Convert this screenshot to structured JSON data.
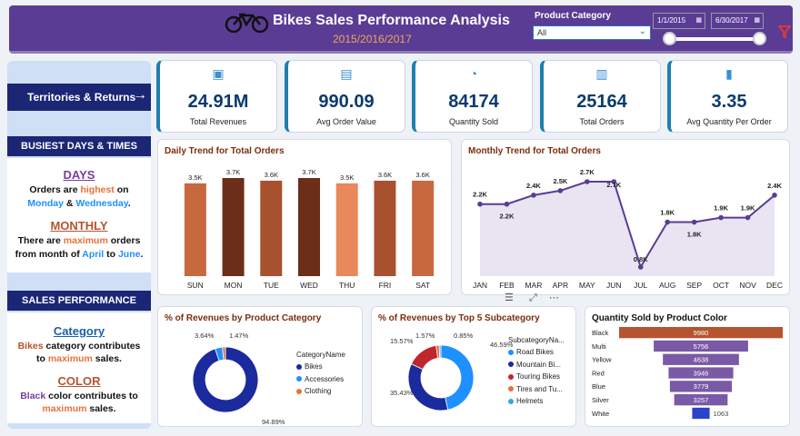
{
  "header": {
    "title": "Bikes Sales Performance Analysis",
    "subtitle": "2015/2016/2017"
  },
  "filters": {
    "product_category_label": "Product Category",
    "product_category_value": "All",
    "start_date": "1/1/2015",
    "end_date": "6/30/2017"
  },
  "left": {
    "territories_button": "Territories & Returns",
    "busiest_header": "BUSIEST DAYS & TIMES",
    "days_heading": "DAYS",
    "days_line1_a": "Orders are ",
    "days_line1_b": "highest",
    "days_line1_c": " on",
    "days_line2_a": "Monday",
    "days_line2_b": " & ",
    "days_line2_c": "Wednesday",
    "days_line2_d": ".",
    "monthly_heading": "MONTHLY",
    "monthly_line1_a": "There are ",
    "monthly_line1_b": "maximum",
    "monthly_line1_c": " orders",
    "monthly_line2_a": "from month of ",
    "monthly_line2_b": "April",
    "monthly_line2_c": " to ",
    "monthly_line2_d": "June",
    "monthly_line2_e": ".",
    "sales_header": "SALES PERFORMANCE",
    "category_heading": "Category",
    "cat_line1_a": "Bikes",
    "cat_line1_b": " category contributes",
    "cat_line2_a": "to ",
    "cat_line2_b": "maximum",
    "cat_line2_c": " sales.",
    "color_heading": "COLOR",
    "color_line1_a": "Black",
    "color_line1_b": " color contributes to",
    "color_line2_a": "maximum",
    "color_line2_b": " sales."
  },
  "kpis": [
    {
      "value": "24.91M",
      "label": "Total Revenues",
      "icon": "money-icon"
    },
    {
      "value": "990.09",
      "label": "Avg Order Value",
      "icon": "clipboard-icon"
    },
    {
      "value": "84174",
      "label": "Quantity Sold",
      "icon": "delivery-icon"
    },
    {
      "value": "25164",
      "label": "Total Orders",
      "icon": "orders-icon"
    },
    {
      "value": "3.35",
      "label": "Avg Quantity Per Order",
      "icon": "bar-chart-icon"
    }
  ],
  "titles": {
    "daily": "Daily Trend for Total Orders",
    "monthly": "Monthly Trend for Total Orders",
    "category": "% of Revenues by Product Category",
    "subcategory": "% of Revenues by Top 5 Subcategory",
    "color": "Quantity Sold by Product Color",
    "category_legend_title": "CategoryName",
    "subcategory_legend_title": "SubcategoryNa..."
  },
  "chart_data": [
    {
      "type": "bar",
      "title": "Daily Trend for Total Orders",
      "categories": [
        "SUN",
        "MON",
        "TUE",
        "WED",
        "THU",
        "FRI",
        "SAT"
      ],
      "values": [
        3.5,
        3.7,
        3.6,
        3.7,
        3.5,
        3.6,
        3.6
      ],
      "labels": [
        "3.5K",
        "3.7K",
        "3.6K",
        "3.7K",
        "3.5K",
        "3.6K",
        "3.6K"
      ],
      "colors": [
        "#c8683f",
        "#6b2e18",
        "#a8512f",
        "#6b2e18",
        "#e9885a",
        "#a8512f",
        "#c8683f"
      ],
      "ylim": [
        0,
        3.7
      ]
    },
    {
      "type": "area",
      "title": "Monthly Trend for Total Orders",
      "categories": [
        "JAN",
        "FEB",
        "MAR",
        "APR",
        "MAY",
        "JUN",
        "JUL",
        "AUG",
        "SEP",
        "OCT",
        "NOV",
        "DEC"
      ],
      "values": [
        2.2,
        2.2,
        2.4,
        2.5,
        2.7,
        2.7,
        0.8,
        1.8,
        1.8,
        1.9,
        1.9,
        2.4
      ],
      "labels": [
        "2.2K",
        "2.2K",
        "2.4K",
        "2.5K",
        "2.7K",
        "2.7K",
        "0.8K",
        "1.8K",
        "1.8K",
        "1.9K",
        "1.9K",
        "2.4K"
      ],
      "line_color": "#5a3c94",
      "fill_color": "#e8e4f2"
    },
    {
      "type": "pie",
      "title": "% of Revenues by Product Category",
      "legend_title": "CategoryName",
      "series": [
        {
          "name": "Bikes",
          "value": 94.89,
          "label": "94.89%",
          "color": "#1b2a9c"
        },
        {
          "name": "Accessories",
          "value": 3.64,
          "label": "3.64%",
          "color": "#1e90ff"
        },
        {
          "name": "Clothing",
          "value": 1.47,
          "label": "1.47%",
          "color": "#e8703a"
        }
      ]
    },
    {
      "type": "pie",
      "title": "% of Revenues by Top 5 Subcategory",
      "legend_title": "SubcategoryNa...",
      "series": [
        {
          "name": "Road Bikes",
          "value": 46.59,
          "label": "46.59%",
          "color": "#1e90ff"
        },
        {
          "name": "Mountain Bi...",
          "value": 35.43,
          "label": "35.43%",
          "color": "#1b2a9c"
        },
        {
          "name": "Touring Bikes",
          "value": 15.57,
          "label": "15.57%",
          "color": "#c0262b"
        },
        {
          "name": "Tires and Tu...",
          "value": 1.57,
          "label": "1.57%",
          "color": "#e8703a"
        },
        {
          "name": "Helmets",
          "value": 0.85,
          "label": "0.85%",
          "color": "#34a8e0"
        }
      ]
    },
    {
      "type": "bar",
      "title": "Quantity Sold by Product Color",
      "orientation": "horizontal-funnel",
      "categories": [
        "Black",
        "Multi",
        "Yellow",
        "Red",
        "Blue",
        "Silver",
        "White"
      ],
      "values": [
        9980,
        5756,
        4638,
        3946,
        3779,
        3257,
        1063
      ],
      "colors": [
        "#b4552e",
        "#7a5aa6",
        "#7a5aa6",
        "#7a5aa6",
        "#7a5aa6",
        "#7a5aa6",
        "#2a43c9"
      ]
    }
  ],
  "visual_header_icons": [
    "filter-lines-icon",
    "focus-mode-icon",
    "more-options-icon"
  ],
  "colors": {
    "header": "#5a3c94",
    "navy": "#1b2675",
    "accent_orange": "#e8703a",
    "accent_blue": "#1e90ff"
  }
}
